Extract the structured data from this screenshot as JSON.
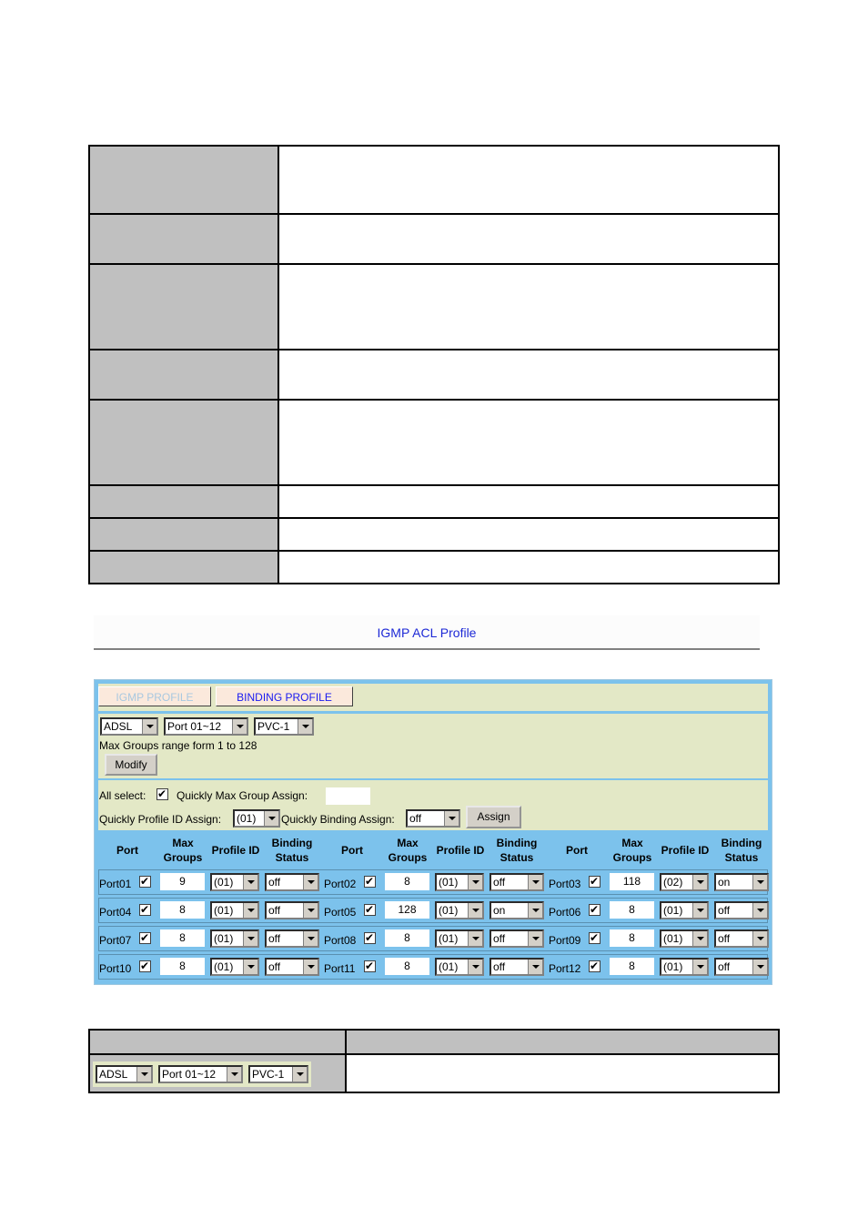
{
  "doc_table": {
    "rows": 8
  },
  "igmp": {
    "title": "IGMP ACL Profile",
    "tabs": [
      {
        "label": "IGMP PROFILE",
        "active": false
      },
      {
        "label": "BINDING PROFILE",
        "active": true
      }
    ],
    "filters": {
      "line_type": "ADSL",
      "port_range": "Port 01~12",
      "pvc": "PVC-1"
    },
    "range_note": "Max Groups range form 1 to 128",
    "modify_label": "Modify",
    "quick": {
      "all_select_label": "All select:",
      "all_select_checked": true,
      "max_group_label": "Quickly Max Group Assign:",
      "max_group_value": "",
      "profile_id_label": "Quickly Profile ID Assign:",
      "profile_id_value": "(01)",
      "binding_label": "Quickly Binding Assign:",
      "binding_value": "off",
      "assign_label": "Assign"
    },
    "headers": {
      "port": "Port",
      "max_groups": "Max Groups",
      "profile_id": "Profile ID",
      "binding_status": "Binding Status"
    },
    "ports": [
      {
        "name": "Port01",
        "checked": true,
        "max_groups": "9",
        "profile_id": "(01)",
        "binding": "off"
      },
      {
        "name": "Port02",
        "checked": true,
        "max_groups": "8",
        "profile_id": "(01)",
        "binding": "off"
      },
      {
        "name": "Port03",
        "checked": true,
        "max_groups": "118",
        "profile_id": "(02)",
        "binding": "on"
      },
      {
        "name": "Port04",
        "checked": true,
        "max_groups": "8",
        "profile_id": "(01)",
        "binding": "off"
      },
      {
        "name": "Port05",
        "checked": true,
        "max_groups": "128",
        "profile_id": "(01)",
        "binding": "on"
      },
      {
        "name": "Port06",
        "checked": true,
        "max_groups": "8",
        "profile_id": "(01)",
        "binding": "off"
      },
      {
        "name": "Port07",
        "checked": true,
        "max_groups": "8",
        "profile_id": "(01)",
        "binding": "off"
      },
      {
        "name": "Port08",
        "checked": true,
        "max_groups": "8",
        "profile_id": "(01)",
        "binding": "off"
      },
      {
        "name": "Port09",
        "checked": true,
        "max_groups": "8",
        "profile_id": "(01)",
        "binding": "off"
      },
      {
        "name": "Port10",
        "checked": true,
        "max_groups": "8",
        "profile_id": "(01)",
        "binding": "off"
      },
      {
        "name": "Port11",
        "checked": true,
        "max_groups": "8",
        "profile_id": "(01)",
        "binding": "off"
      },
      {
        "name": "Port12",
        "checked": true,
        "max_groups": "8",
        "profile_id": "(01)",
        "binding": "off"
      }
    ]
  },
  "bottom_table": {
    "filters": {
      "line_type": "ADSL",
      "port_range": "Port 01~12",
      "pvc": "PVC-1"
    }
  },
  "colors": {
    "panel_blue": "#7cc2ec",
    "section_bg": "#e3e8c6",
    "title_blue": "#1d29d6",
    "table_gray": "#c0c0c0"
  }
}
